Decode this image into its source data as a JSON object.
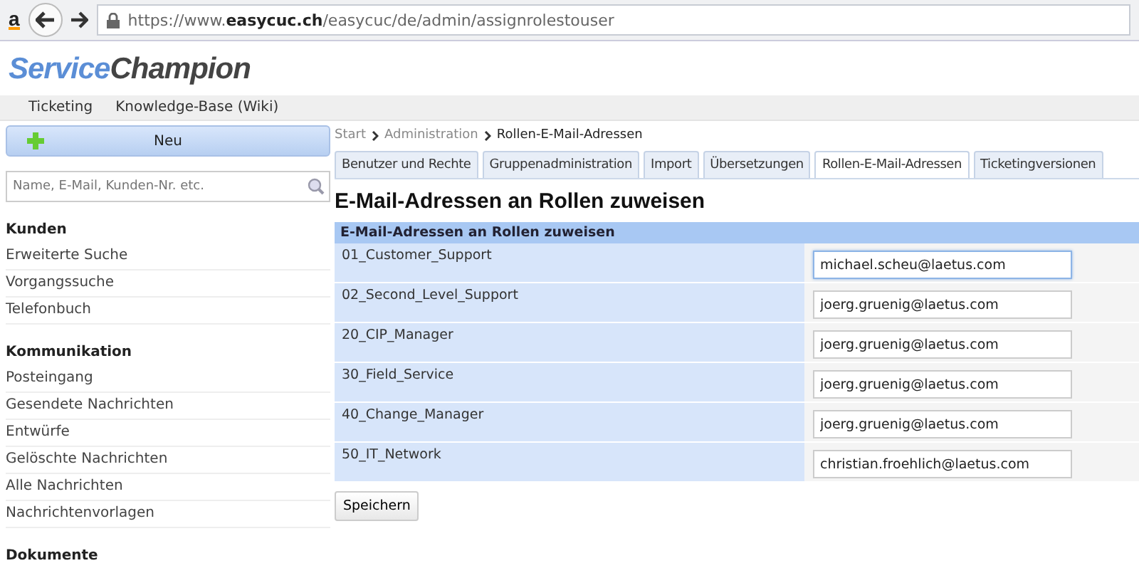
{
  "browser": {
    "extension": "a",
    "url": "https://www.**easycuc.ch**/easycuc/de/admin/assignrolestouser"
  },
  "logo": {
    "part1": "Service",
    "part2": "Champion"
  },
  "nav": [
    "Ticketing",
    "Knowledge-Base (Wiki)"
  ],
  "sidebar": {
    "new_button": "Neu",
    "search": {
      "placeholder": "Name, E-Mail, Kunden-Nr. etc."
    },
    "sections": [
      {
        "title": "Kunden",
        "items": [
          "Erweiterte Suche",
          "Vorgangssuche",
          "Telefonbuch"
        ]
      },
      {
        "title": "Kommunikation",
        "items": [
          "Posteingang",
          "Gesendete Nachrichten",
          "Entwürfe",
          "Gelöschte Nachrichten",
          "Alle Nachrichten",
          "Nachrichtenvorlagen"
        ]
      },
      {
        "title": "Dokumente"
      }
    ]
  },
  "breadcrumb": [
    {
      "label": "Start",
      "current": false
    },
    {
      "label": "Administration",
      "current": false
    },
    {
      "label": "Rollen-E-Mail-Adressen",
      "current": true
    }
  ],
  "tabs": [
    {
      "label": "Benutzer und Rechte",
      "selected": false
    },
    {
      "label": "Gruppenadministration",
      "selected": false
    },
    {
      "label": "Import",
      "selected": false
    },
    {
      "label": "Übersetzungen",
      "selected": false
    },
    {
      "label": "Rollen-E-Mail-Adressen",
      "selected": true
    },
    {
      "label": "Ticketingversionen",
      "selected": false
    }
  ],
  "heading": "E-Mail-Adressen an Rollen zuweisen",
  "table": {
    "caption": "E-Mail-Adressen an Rollen zuweisen",
    "rows": [
      {
        "role": "01_Customer_Support",
        "email": "michael.scheu@laetus.com",
        "focused": true
      },
      {
        "role": "02_Second_Level_Support",
        "email": "joerg.gruenig@laetus.com",
        "focused": false
      },
      {
        "role": "20_CIP_Manager",
        "email": "joerg.gruenig@laetus.com",
        "focused": false
      },
      {
        "role": "30_Field_Service",
        "email": "joerg.gruenig@laetus.com",
        "focused": false
      },
      {
        "role": "40_Change_Manager",
        "email": "joerg.gruenig@laetus.com",
        "focused": false
      },
      {
        "role": "50_IT_Network",
        "email": "christian.froehlich@laetus.com",
        "focused": false
      }
    ]
  },
  "save_button": "Speichern"
}
